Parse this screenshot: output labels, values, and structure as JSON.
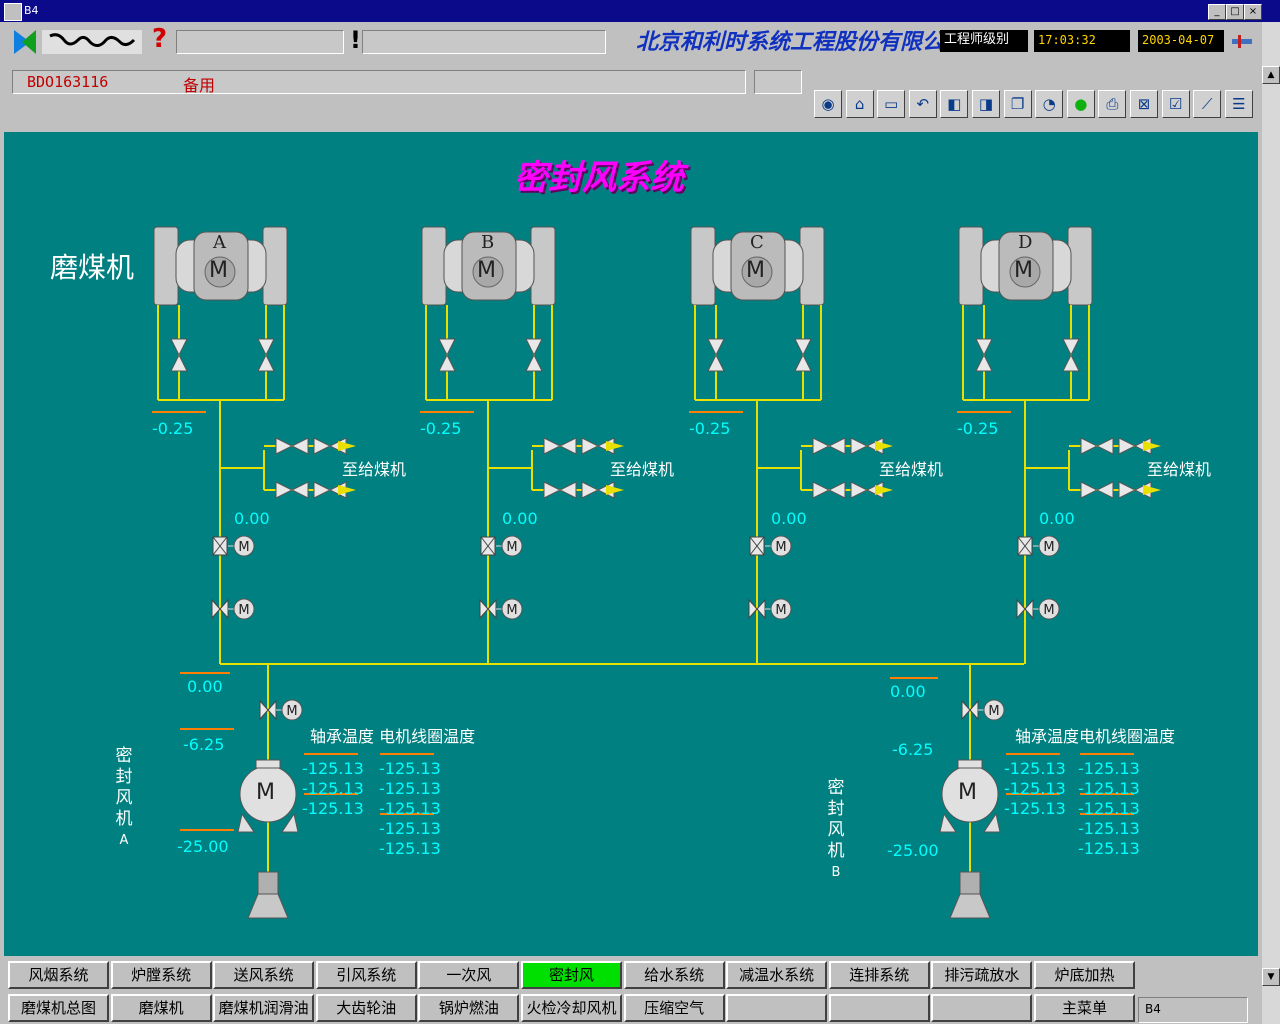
{
  "window": {
    "title": "B4",
    "min": "_",
    "max": "□",
    "close": "×"
  },
  "header": {
    "company": "北京和利时系统工程股份有限公司",
    "user_level": "工程师级别",
    "time": "17:03:32",
    "date": "2003-04-07",
    "help_mark": "?",
    "alarm_mark": "!",
    "tag_code": "BDO163116",
    "tag_desc": "备用"
  },
  "toolbar_icons": [
    "overview-icon",
    "home-icon",
    "device-icon",
    "back-icon",
    "prev-page-icon",
    "next-page-icon",
    "copy-icon",
    "alarm-clock-icon",
    "status-light-icon",
    "print-icon",
    "alarm-ack-icon",
    "event-icon",
    "trend-icon",
    "report-icon"
  ],
  "diagram": {
    "title": "密封风系统",
    "mill_label": "磨煤机",
    "mills": [
      {
        "letter": "A",
        "pressure": "-0.25",
        "flow": "0.00",
        "dest": "至给煤机"
      },
      {
        "letter": "B",
        "pressure": "-0.25",
        "flow": "0.00",
        "dest": "至给煤机"
      },
      {
        "letter": "C",
        "pressure": "-0.25",
        "flow": "0.00",
        "dest": "至给煤机"
      },
      {
        "letter": "D",
        "pressure": "-0.25",
        "flow": "0.00",
        "dest": "至给煤机"
      }
    ],
    "motor_letter": "M",
    "fans": [
      {
        "name": [
          "密",
          "封",
          "风",
          "机",
          "A"
        ],
        "outlet": "0.00",
        "pressure": "-6.25",
        "inlet": "-25.00",
        "temp_header": "轴承温度 电机线圈温度",
        "bearing": [
          "-125.13",
          "-125.13",
          "-125.13"
        ],
        "coil": [
          "-125.13",
          "-125.13",
          "-125.13",
          "-125.13",
          "-125.13"
        ]
      },
      {
        "name": [
          "密",
          "封",
          "风",
          "机",
          "B"
        ],
        "outlet": "0.00",
        "pressure": "-6.25",
        "inlet": "-25.00",
        "temp_header": "轴承温度电机线圈温度",
        "bearing": [
          "-125.13",
          "-125.13",
          "-125.13"
        ],
        "coil": [
          "-125.13",
          "-125.13",
          "-125.13",
          "-125.13",
          "-125.13"
        ]
      }
    ]
  },
  "nav": {
    "row1": [
      "风烟系统",
      "炉膛系统",
      "送风系统",
      "引风系统",
      "一次风",
      "密封风",
      "给水系统",
      "减温水系统",
      "连排系统",
      "排污疏放水",
      "炉底加热"
    ],
    "row2": [
      "磨煤机总图",
      "磨煤机",
      "磨煤机润滑油",
      "大齿轮油",
      "锅炉燃油",
      "火检冷却风机",
      "压缩空气",
      "",
      "",
      "",
      "主菜单"
    ],
    "active": "密封风",
    "station": "B4"
  },
  "colors": {
    "background": "#008080",
    "pipe": "#e8e000",
    "value": "#00ffff",
    "title": "#ff00ff",
    "active_tab": "#00e000"
  }
}
